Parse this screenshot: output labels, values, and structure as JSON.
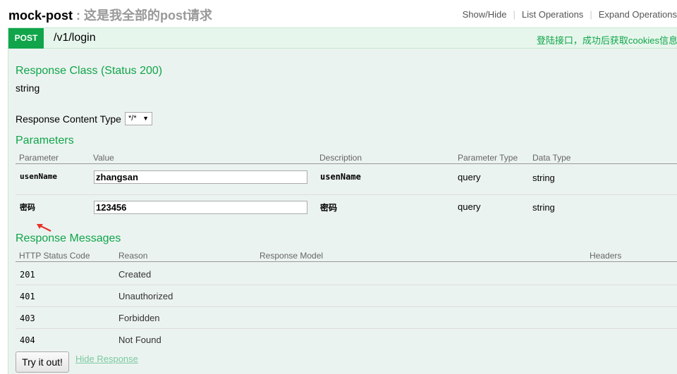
{
  "header": {
    "api_name": "mock-post",
    "separator": " : ",
    "api_description": "这是我全部的post请求",
    "links": [
      "Show/Hide",
      "List Operations",
      "Expand Operations"
    ]
  },
  "operation": {
    "method": "POST",
    "path": "/v1/login",
    "summary": "登陆接口，成功后获取cookies信息"
  },
  "response_class": {
    "title": "Response Class (Status 200)",
    "type": "string"
  },
  "content_type": {
    "label": "Response Content Type",
    "selected": "*/*"
  },
  "parameters": {
    "title": "Parameters",
    "headers": [
      "Parameter",
      "Value",
      "Description",
      "Parameter Type",
      "Data Type"
    ],
    "rows": [
      {
        "name": "usenName",
        "value": "zhangsan",
        "description": "usenName",
        "param_type": "query",
        "data_type": "string"
      },
      {
        "name": "密码",
        "value": "123456",
        "description": "密码",
        "param_type": "query",
        "data_type": "string"
      }
    ]
  },
  "response_messages": {
    "title": "Response Messages",
    "headers": [
      "HTTP Status Code",
      "Reason",
      "Response Model",
      "Headers"
    ],
    "rows": [
      {
        "code": "201",
        "reason": "Created"
      },
      {
        "code": "401",
        "reason": "Unauthorized"
      },
      {
        "code": "403",
        "reason": "Forbidden"
      },
      {
        "code": "404",
        "reason": "Not Found"
      }
    ]
  },
  "actions": {
    "try_label": "Try it out!",
    "hide_label": "Hide Response"
  },
  "colors": {
    "accent": "#10a54a",
    "panel_bg": "#ebf3f0",
    "annotation_arrow": "#e8322b"
  }
}
